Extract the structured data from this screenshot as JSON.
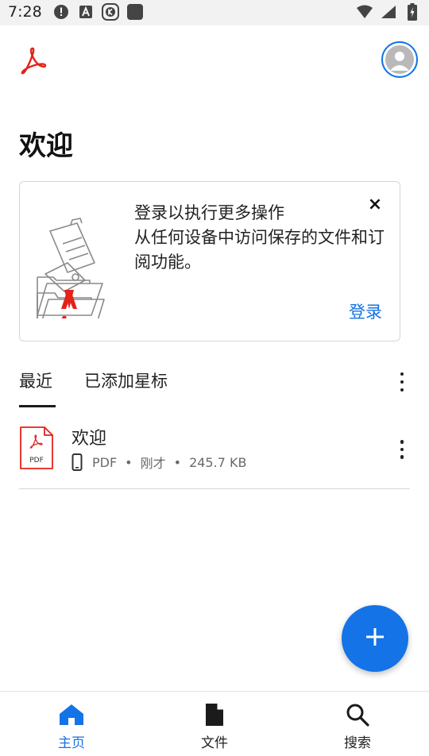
{
  "status_bar": {
    "time": "7:28",
    "left_icons": [
      "alert-circle-icon",
      "font-a-icon",
      "k-app-icon",
      "square-app-icon"
    ],
    "right_icons": [
      "wifi-icon",
      "signal-icon",
      "battery-charging-icon"
    ]
  },
  "header": {
    "logo": "acrobat-logo-icon",
    "avatar": "user-avatar-icon"
  },
  "page": {
    "title": "欢迎"
  },
  "signin_card": {
    "message_line1": "登录以执行更多操作",
    "message_line2": "从任何设备中访问保存的文件和订阅功能。",
    "close": "×",
    "signin_label": "登录"
  },
  "tabs": {
    "items": [
      {
        "label": "最近",
        "active": true
      },
      {
        "label": "已添加星标",
        "active": false
      }
    ]
  },
  "files": [
    {
      "name": "欢迎",
      "icon_label": "PDF",
      "type": "PDF",
      "modified": "刚才",
      "size": "245.7 KB"
    }
  ],
  "bottom_nav": {
    "items": [
      {
        "label": "主页",
        "icon": "home-icon",
        "active": true
      },
      {
        "label": "文件",
        "icon": "file-icon",
        "active": false
      },
      {
        "label": "搜索",
        "icon": "search-icon",
        "active": false
      }
    ]
  },
  "colors": {
    "accent": "#1473e6",
    "acrobat_red": "#e2231a",
    "divider": "#d6d6d6"
  }
}
